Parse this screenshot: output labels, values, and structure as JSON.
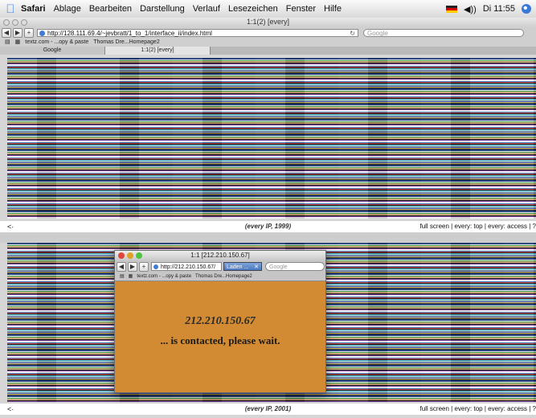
{
  "menubar": {
    "app": "Safari",
    "items": [
      "Ablage",
      "Bearbeiten",
      "Darstellung",
      "Verlauf",
      "Lesezeichen",
      "Fenster",
      "Hilfe"
    ],
    "clock": "Di 11:55",
    "volume": "◀))"
  },
  "browser": {
    "window_title": "1:1(2) [every]",
    "url": "http://128.111.69.4/~jevbratt/1_to_1/interface_ii/index.html",
    "search_placeholder": "Google",
    "bookmarks": [
      "textz.com - ...opy & paste",
      "Thomas Dre...Homepage2"
    ],
    "tabs": [
      "Google",
      "1:1(2) [every]"
    ]
  },
  "panels": [
    {
      "caption": "(every IP, 1999)",
      "links": "full screen | every: top | every: access | ?"
    },
    {
      "caption": "(every IP, 2001)",
      "links": "full screen | every: top | every: access | ?"
    }
  ],
  "popup": {
    "title": "1:1 [212.210.150.67]",
    "url": "http://212.210.150.67/",
    "loading_tab": "Laden ...",
    "search_placeholder": "Google",
    "bookmarks": [
      "textz.com - ...opy & paste",
      "Thomas Dre...Homepage2"
    ],
    "ip": "212.210.150.67",
    "message": "... is contacted, please wait.",
    "background_color": "#d28b32"
  }
}
